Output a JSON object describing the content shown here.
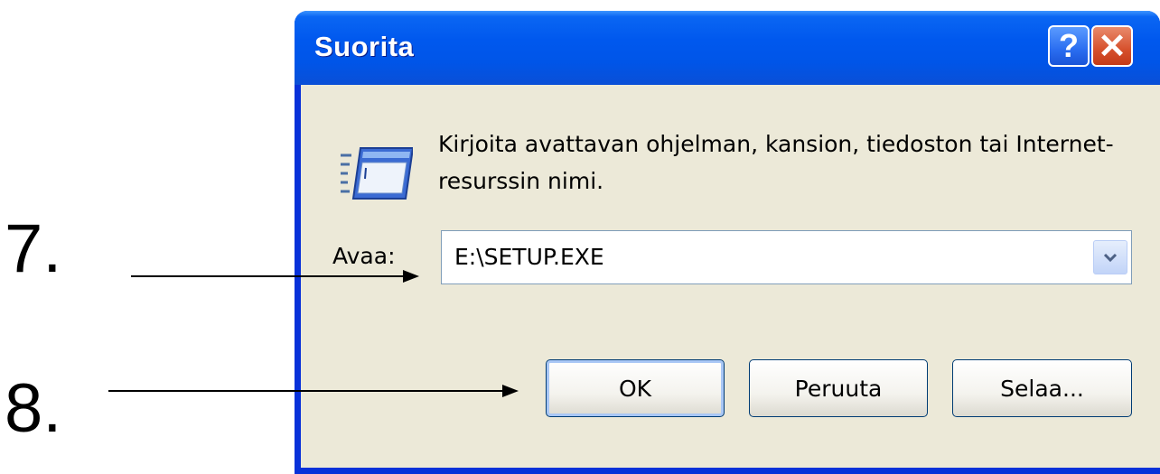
{
  "annotations": {
    "step7": "7.",
    "step8": "8."
  },
  "window": {
    "title": "Suorita",
    "help_glyph": "?",
    "close_glyph": "✕"
  },
  "dialog": {
    "description": "Kirjoita avattavan ohjelman, kansion, tiedoston tai Internet-resurssin nimi.",
    "open_label": "Avaa:",
    "open_value": "E:\\SETUP.EXE",
    "buttons": {
      "ok": "OK",
      "cancel": "Peruuta",
      "browse": "Selaa..."
    }
  },
  "colors": {
    "titlebar": "#0055e8",
    "dialog_bg": "#ece9d8",
    "close_button": "#d6502c"
  },
  "icons": {
    "dialog_icon": "run-icon",
    "dropdown": "chevron-down-icon"
  }
}
